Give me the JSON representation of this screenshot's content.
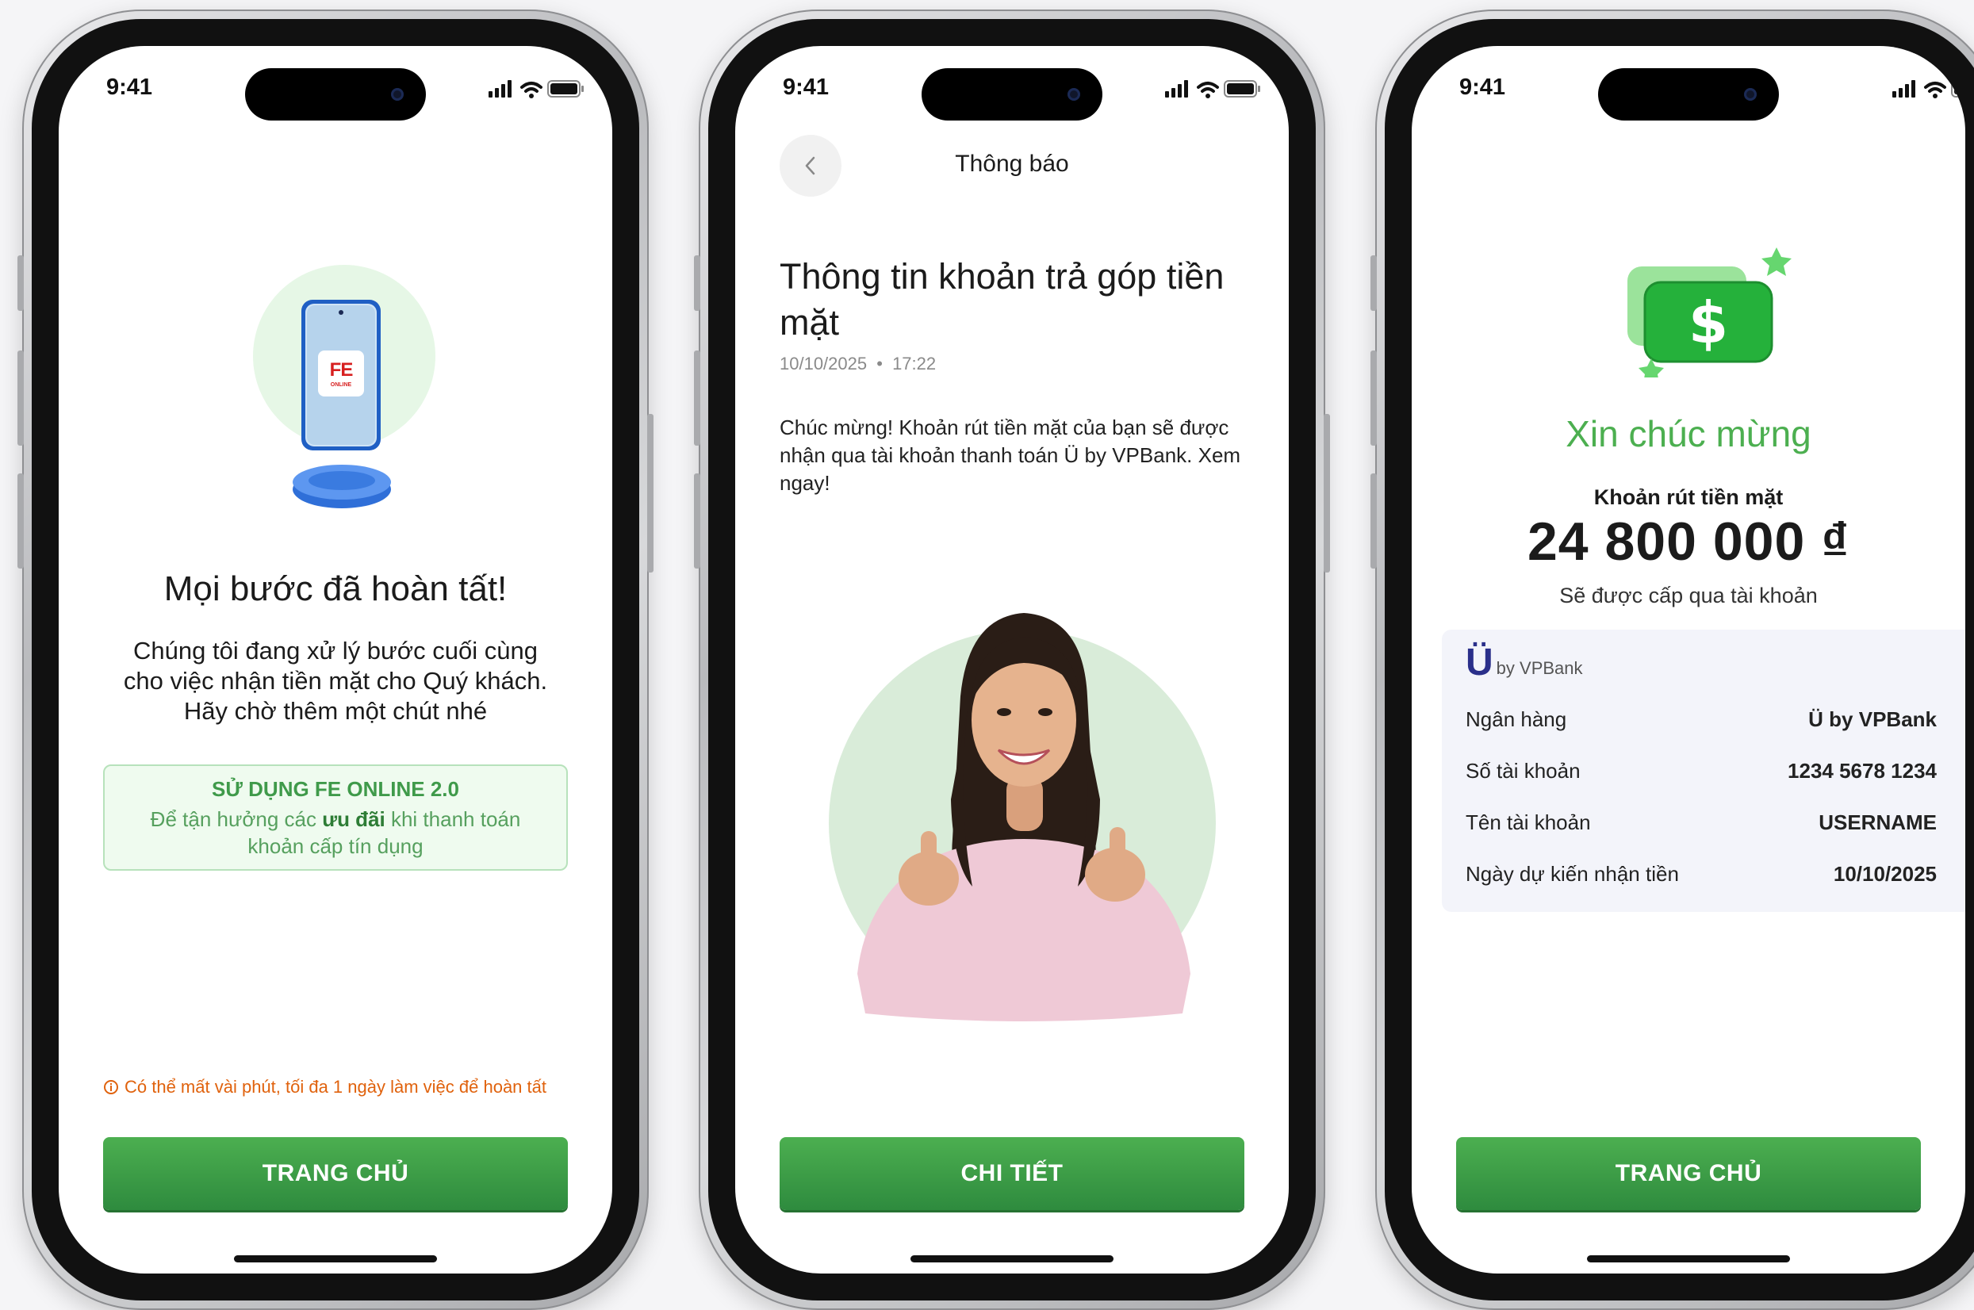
{
  "status_time": "9:41",
  "colors": {
    "brand_green": "#4caf50",
    "warning_orange": "#e0620d"
  },
  "screen1": {
    "logo_text": "FE",
    "logo_subtext": "ONLINE",
    "title": "Mọi bước đã hoàn tất!",
    "description": [
      "Chúng tôi đang xử lý bước cuối cùng",
      "cho việc nhận tiền mặt cho Quý khách.",
      "Hãy chờ thêm một chút nhé"
    ],
    "promo": {
      "title": "SỬ DỤNG FE ONLINE 2.0",
      "desc_before": "Để tận hưởng các ",
      "desc_bold": "ưu đãi",
      "desc_after": " khi thanh toán khoản cấp tín dụng"
    },
    "warning": "Có thể mất vài phút, tối đa 1 ngày làm việc để hoàn tất",
    "button": "TRANG CHỦ"
  },
  "screen2": {
    "nav_title": "Thông báo",
    "title": "Thông tin khoản trả góp tiền mặt",
    "date": "10/10/2025",
    "time": "17:22",
    "body": "Chúc mừng! Khoản rút tiền mặt của bạn sẽ được nhận qua tài khoản thanh toán Ü by VPBank. Xem ngay!",
    "button": "CHI TIẾT"
  },
  "screen3": {
    "title": "Xin chúc mừng",
    "subtitle": "Khoản rút tiền mặt",
    "amount": "24 800 000 ₫",
    "note": "Sẽ được cấp qua tài khoản",
    "bank_logo_big": "Ü",
    "bank_logo_small": "by VPBank",
    "rows": [
      {
        "label": "Ngân hàng",
        "value": "Ü by VPBank"
      },
      {
        "label": "Số tài khoản",
        "value": "1234 5678 1234"
      },
      {
        "label": "Tên tài khoản",
        "value": "USERNAME"
      },
      {
        "label": "Ngày dự kiến nhận tiền",
        "value": "10/10/2025"
      }
    ],
    "button": "TRANG CHỦ"
  }
}
